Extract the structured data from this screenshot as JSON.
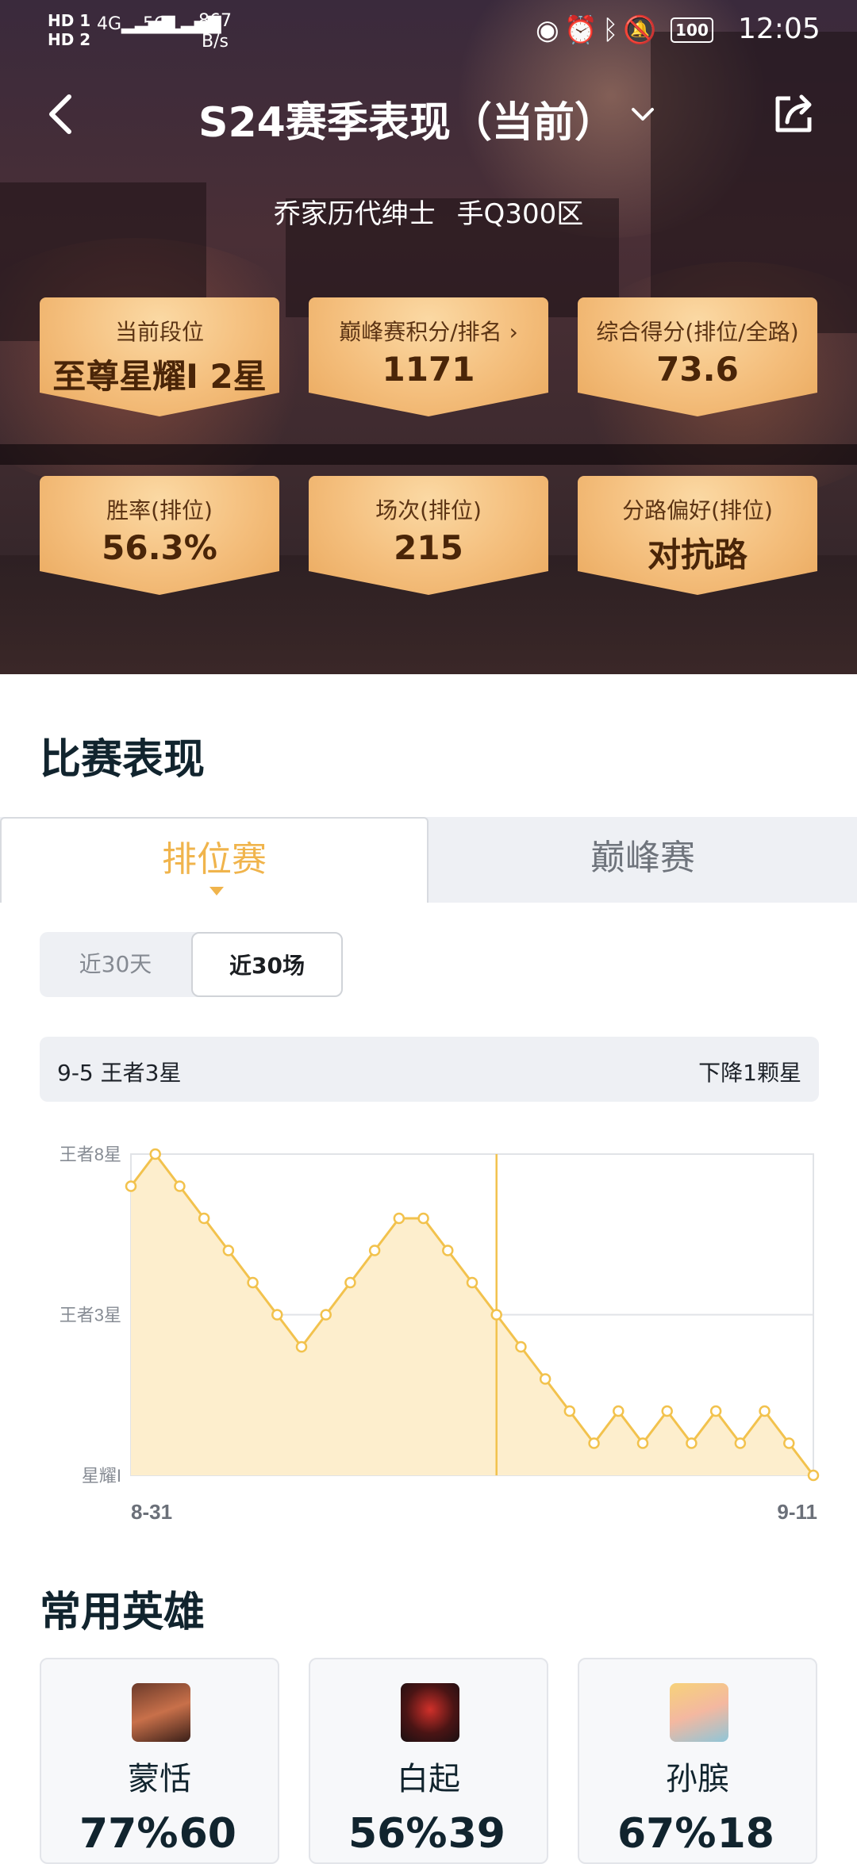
{
  "status_bar": {
    "hd1": "HD 1",
    "hd2": "HD 2",
    "net1": "4G",
    "net2": "5G",
    "speed_value": "867",
    "speed_unit": "B/s",
    "battery": "100",
    "time": "12:05"
  },
  "header": {
    "title": "S24赛季表现（当前）",
    "player_name": "乔家历代绅士",
    "server": "手Q300区"
  },
  "stats": [
    {
      "label": "当前段位",
      "value": "至尊星耀I 2星"
    },
    {
      "label": "巅峰赛积分/排名",
      "value": "1171"
    },
    {
      "label": "综合得分(排位/全路)",
      "value": "73.6"
    },
    {
      "label": "胜率(排位)",
      "value": "56.3%"
    },
    {
      "label": "场次(排位)",
      "value": "215"
    },
    {
      "label": "分路偏好(排位)",
      "value": "对抗路"
    }
  ],
  "performance": {
    "section_title": "比赛表现",
    "tabs": [
      "排位赛",
      "巅峰赛"
    ],
    "active_tab": "排位赛",
    "range_options": [
      "近30天",
      "近30场"
    ],
    "active_range": "近30场",
    "info_left": "9-5 王者3星",
    "info_right": "下降1颗星"
  },
  "chart_data": {
    "type": "line",
    "y_tick_labels": [
      "王者8星",
      "王者3星",
      "星耀I"
    ],
    "y_tick_values": [
      8,
      3,
      -2
    ],
    "x_start_label": "8-31",
    "x_end_label": "9-11",
    "ylim": [
      -2,
      8
    ],
    "values": [
      7,
      8,
      7,
      6,
      5,
      4,
      3,
      2,
      3,
      4,
      5,
      6,
      6,
      5,
      4,
      3,
      2,
      1,
      0,
      -1,
      0,
      -1,
      0,
      -1,
      0,
      -1,
      0,
      -1,
      -2
    ],
    "highlight_index": 15,
    "color_line": "#f2c24d",
    "color_fill": "#fdeecd"
  },
  "heroes": {
    "section_title": "常用英雄",
    "items": [
      {
        "name": "蒙恬",
        "win_rate": "77%",
        "games": "60"
      },
      {
        "name": "白起",
        "win_rate": "56%",
        "games": "39"
      },
      {
        "name": "孙膑",
        "win_rate": "67%",
        "games": "18"
      }
    ]
  }
}
